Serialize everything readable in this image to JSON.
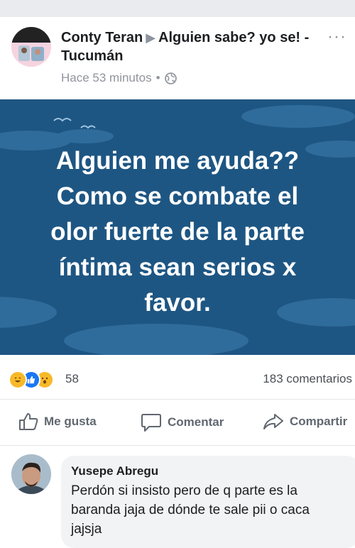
{
  "post": {
    "author": "Conty Teran",
    "group": "Alguien sabe? yo se! - Tucumán",
    "time": "Hace 53 minutos",
    "separator": "•",
    "more_icon": "more-dots-icon",
    "audience_icon": "globe-icon",
    "banner_text": "Alguien me ayuda??\nComo se combate el\nolor fuerte de la parte\níntima  sean serios x\nfavor.",
    "banner_color": "#1e5683"
  },
  "reactions": {
    "count": "58",
    "icons": [
      "haha-icon",
      "like-icon",
      "wow-icon"
    ],
    "comments": "183 comentarios"
  },
  "actions": {
    "like": "Me gusta",
    "comment": "Comentar",
    "share": "Compartir"
  },
  "comment": {
    "author": "Yusepe Abregu",
    "text": "Perdón si insisto pero de q parte es la baranda jaja de dónde te sale pii  o caca jajsja"
  }
}
